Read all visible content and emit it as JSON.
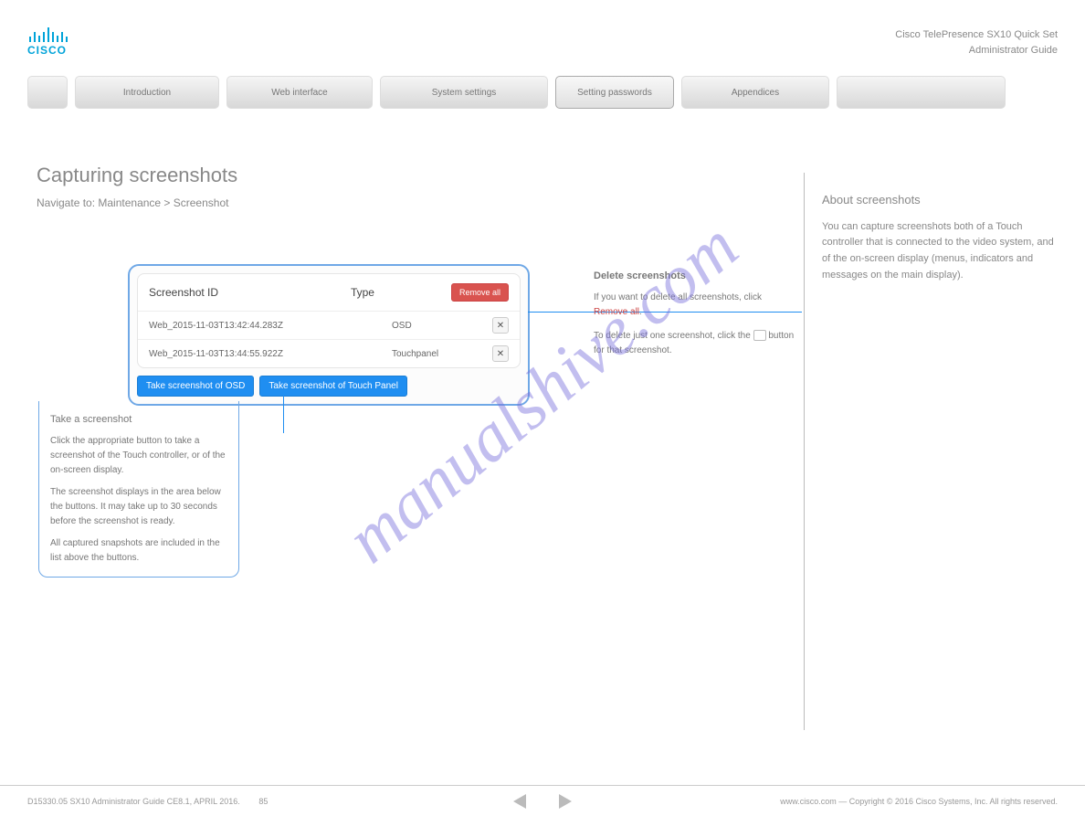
{
  "header": {
    "logo_text": "CISCO",
    "doc_line1": "Cisco TelePresence SX10 Quick Set",
    "doc_line2": "Administrator Guide"
  },
  "tabs": [
    {
      "label": ""
    },
    {
      "label": "Introduction"
    },
    {
      "label": "Web interface"
    },
    {
      "label": "System settings"
    },
    {
      "label": "Setting passwords"
    },
    {
      "label": "Appendices"
    },
    {
      "label": ""
    }
  ],
  "active_tab_index": 4,
  "page": {
    "title": "Capturing screenshots",
    "subtitle": "Navigate to: Maintenance > Screenshot"
  },
  "about": {
    "heading": "About screenshots",
    "text": "You can capture screenshots both of a Touch controller that is connected to the video system, and of the on-screen display (menus, indicators and messages on the main display)."
  },
  "ui_panel": {
    "col_id": "Screenshot ID",
    "col_type": "Type",
    "remove_all": "Remove all",
    "rows": [
      {
        "id": "Web_2015-11-03T13:42:44.283Z",
        "type": "OSD"
      },
      {
        "id": "Web_2015-11-03T13:44:55.922Z",
        "type": "Touchpanel"
      }
    ],
    "btn_osd": "Take screenshot of OSD",
    "btn_touch": "Take screenshot of Touch Panel"
  },
  "callout_take": {
    "heading": "Take a screenshot",
    "p1": "Click the appropriate button to take a screenshot of the Touch controller, or of the on-screen display.",
    "p2": "The screenshot displays in the area below the buttons. It may take up to 30 seconds before the screenshot is ready.",
    "p3": "All captured snapshots are included in the list above the buttons."
  },
  "callout_delete": {
    "heading": "Delete screenshots",
    "p1": "If you want to delete all screenshots, click ",
    "remove_all": "Remove all",
    "p2": "To delete just one screenshot, click the ",
    "p3": " button for that screenshot."
  },
  "footer": {
    "left": "D15330.05 SX10 Administrator Guide CE8.1, APRIL 2016.",
    "right": "www.cisco.com — Copyright © 2016 Cisco Systems, Inc. All rights reserved.",
    "page_no": "85",
    "count_symbol": ""
  },
  "watermark": "manualshive.com"
}
